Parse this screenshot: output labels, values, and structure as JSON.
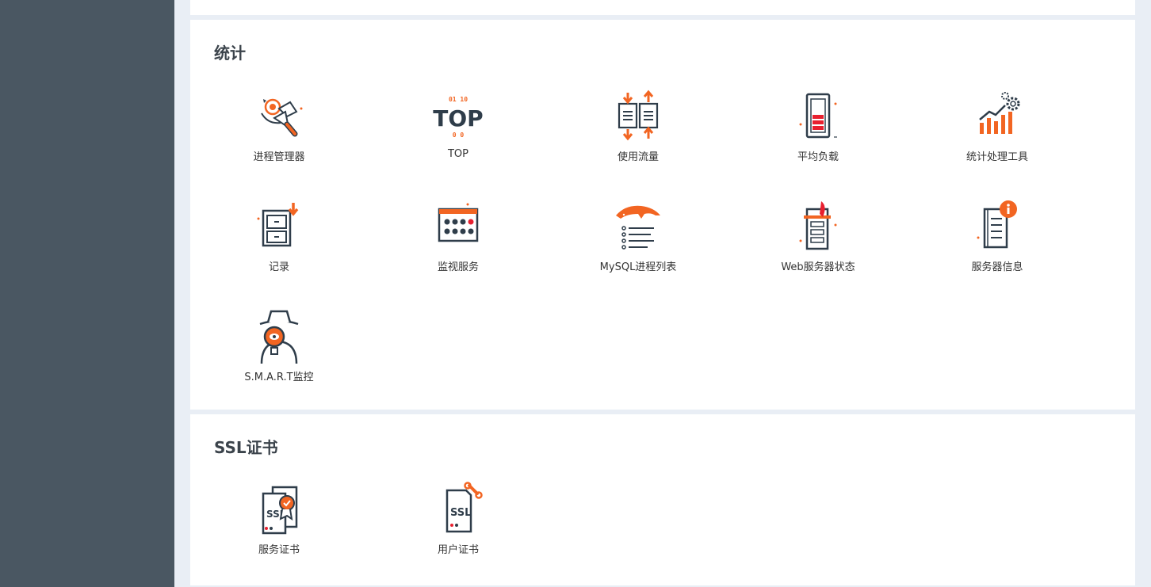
{
  "sections": {
    "stats": {
      "title": "统计",
      "items": [
        {
          "label": "进程管理器",
          "icon": "process-manager-icon"
        },
        {
          "label": "TOP",
          "icon": "top-icon"
        },
        {
          "label": "使用流量",
          "icon": "traffic-usage-icon"
        },
        {
          "label": "平均负载",
          "icon": "load-average-icon"
        },
        {
          "label": "统计处理工具",
          "icon": "statistics-tool-icon"
        },
        {
          "label": "记录",
          "icon": "logs-icon"
        },
        {
          "label": "监视服务",
          "icon": "service-monitor-icon"
        },
        {
          "label": "MySQL进程列表",
          "icon": "mysql-dolphin-icon"
        },
        {
          "label": "Web服务器状态",
          "icon": "web-server-status-icon"
        },
        {
          "label": "服务器信息",
          "icon": "server-info-icon"
        },
        {
          "label": "S.M.A.R.T监控",
          "icon": "smart-monitor-spy-icon"
        }
      ]
    },
    "ssl": {
      "title": "SSL证书",
      "items": [
        {
          "label": "服务证书",
          "icon": "server-certificate-icon",
          "badge": "SSL"
        },
        {
          "label": "用户证书",
          "icon": "user-certificate-icon",
          "badge": "SSL"
        }
      ]
    }
  },
  "colors": {
    "accent": "#f26522",
    "dark": "#2f3d4a",
    "sidebar": "#4a5762",
    "background": "#e9eef5"
  },
  "top_icon": {
    "bits_top": "01  10",
    "bits_bottom": "0    0",
    "word": "TOP"
  }
}
